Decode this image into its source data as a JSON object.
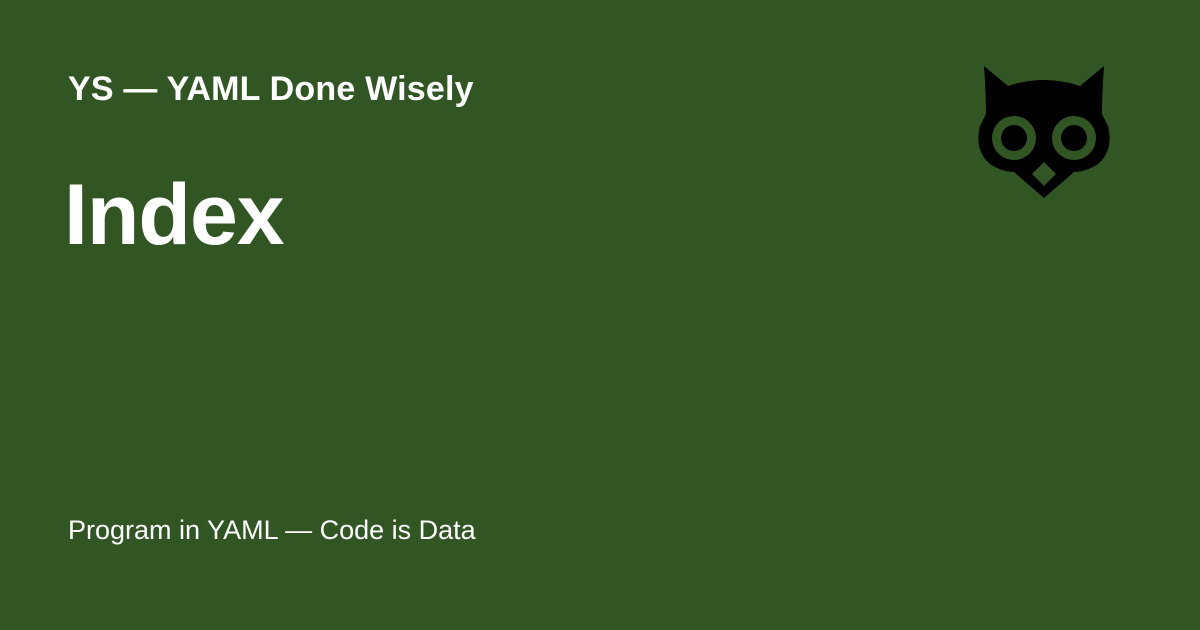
{
  "card": {
    "site_name": "YS — YAML Done Wisely",
    "page_title": "Index",
    "tagline": "Program in YAML — Code is Data",
    "logo_icon": "owl-icon"
  },
  "colors": {
    "background": "#325524",
    "text": "#ffffff",
    "logo": "#000000"
  }
}
